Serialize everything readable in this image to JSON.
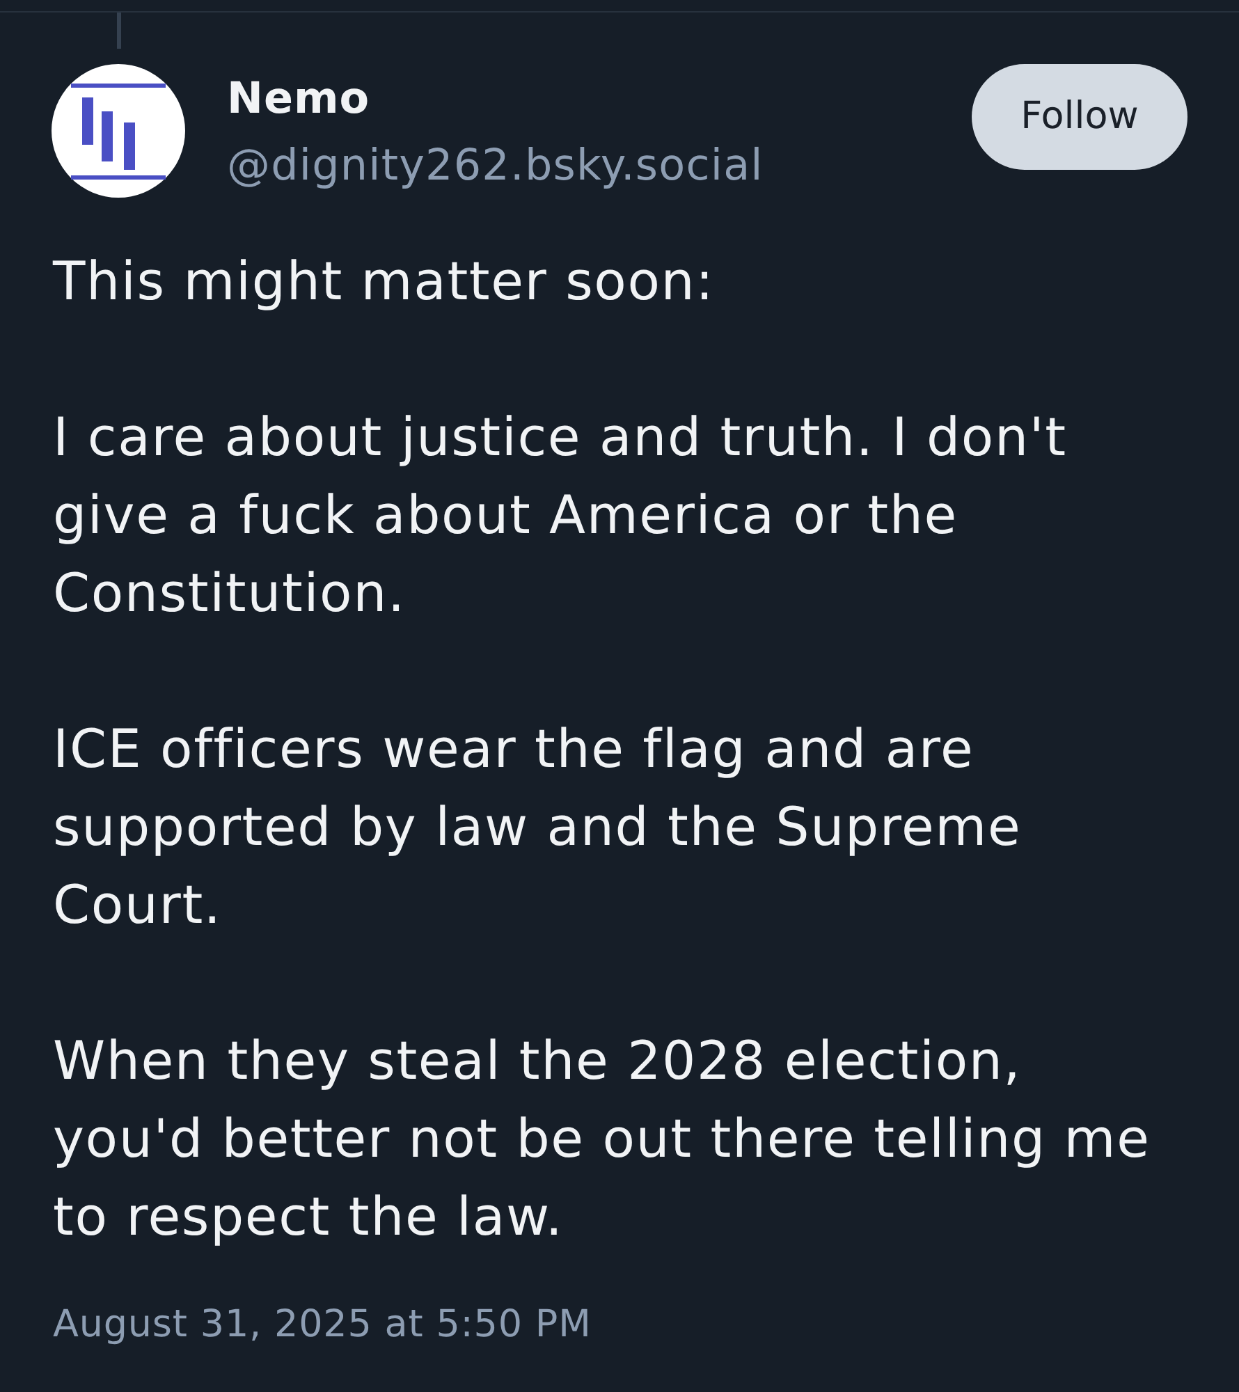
{
  "author": {
    "name": "Nemo",
    "handle": "@dignity262.bsky.social"
  },
  "follow_button": {
    "label": "Follow"
  },
  "post": {
    "paragraphs": [
      "This might matter soon:",
      "I care about justice and truth. I don't give a fuck about America or the Constitution.",
      "ICE officers wear the flag and are supported by law and the Supreme Court.",
      "When they steal the 2028 election, you'd better not be out there telling me to respect the law."
    ],
    "timestamp": "August 31, 2025 at 5:50 PM"
  }
}
